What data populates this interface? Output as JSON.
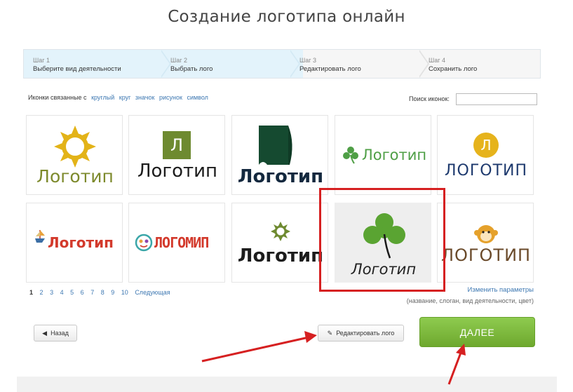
{
  "page_title": "Создание логотипа онлайн",
  "steps": [
    {
      "num": "Шаг 1",
      "label": "Выберите вид деятельности"
    },
    {
      "num": "Шаг 2",
      "label": "Выбрать лого"
    },
    {
      "num": "Шаг 3",
      "label": "Редактировать лого"
    },
    {
      "num": "Шаг 4",
      "label": "Сохранить лого"
    }
  ],
  "filter": {
    "label": "Иконки связанные с",
    "tags": [
      "круглый",
      "круг",
      "значок",
      "рисунок",
      "символ"
    ]
  },
  "search": {
    "label": "Поиск иконок:",
    "value": ""
  },
  "logos": [
    {
      "text": "Логотип",
      "icon": "sun-icon"
    },
    {
      "text": "Логотип",
      "icon": "letter-l-square-icon",
      "mark": "Л"
    },
    {
      "text": "Логотип",
      "icon": "scroll-icon"
    },
    {
      "text": "Логотип",
      "icon": "clover-small-icon"
    },
    {
      "text": "ЛОГОТИП",
      "icon": "letter-l-circle-icon",
      "mark": "Л"
    },
    {
      "text": "Логотип",
      "icon": "ship-icon"
    },
    {
      "text": "ЛОГОМИП",
      "icon": "smiley-icon"
    },
    {
      "text": "Логотип",
      "icon": "gear-icon"
    },
    {
      "text": "Логотип",
      "icon": "clover-icon"
    },
    {
      "text": "ЛОГОТИП",
      "icon": "monkey-icon"
    }
  ],
  "pagination": {
    "current": "1",
    "pages": [
      "2",
      "3",
      "4",
      "5",
      "6",
      "7",
      "8",
      "9",
      "10"
    ],
    "next": "Следующая"
  },
  "change_params": "Изменить параметры",
  "params_hint": "(название, слоган, вид деятельности, цвет)",
  "buttons": {
    "back": "Назад",
    "edit": "Редактировать лого",
    "next": "ДАЛЕЕ"
  },
  "colors": {
    "accent_green": "#7ab83d",
    "highlight_red": "#d62021",
    "step_active": "#e3f3fb"
  }
}
